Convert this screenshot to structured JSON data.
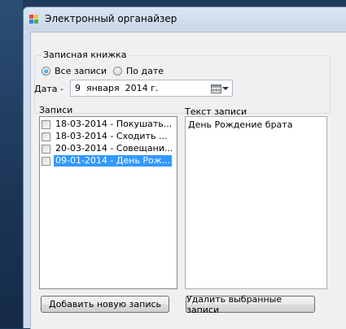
{
  "window": {
    "title": "Электронный органайзер"
  },
  "notebook_group": {
    "title": "Записная книжка",
    "radio_all": "Все записи",
    "radio_by_date": "По дате",
    "selected_radio": "all"
  },
  "date_filter": {
    "label": "Дата -",
    "value": "9  января  2014 г."
  },
  "entries": {
    "label": "Записи",
    "items": [
      {
        "text": "18-03-2014 - Покушать...",
        "checked": false,
        "selected": false
      },
      {
        "text": "18-03-2014 - Сходить ...",
        "checked": false,
        "selected": false
      },
      {
        "text": "20-03-2014 - Совещани...",
        "checked": false,
        "selected": false
      },
      {
        "text": "09-01-2014 - День Рож...",
        "checked": false,
        "selected": true
      }
    ]
  },
  "entry_text": {
    "label": "Текст записи",
    "value": "День Рождение брата"
  },
  "buttons": {
    "add": "Добавить новую запись",
    "delete": "Удалить выбранные записи"
  },
  "icons": {
    "app": "organizer-app-icon",
    "calendar": "calendar-icon",
    "dropdown": "chevron-down-icon"
  },
  "colors": {
    "selection": "#3399ff",
    "window_frame": "#cfdbea"
  }
}
